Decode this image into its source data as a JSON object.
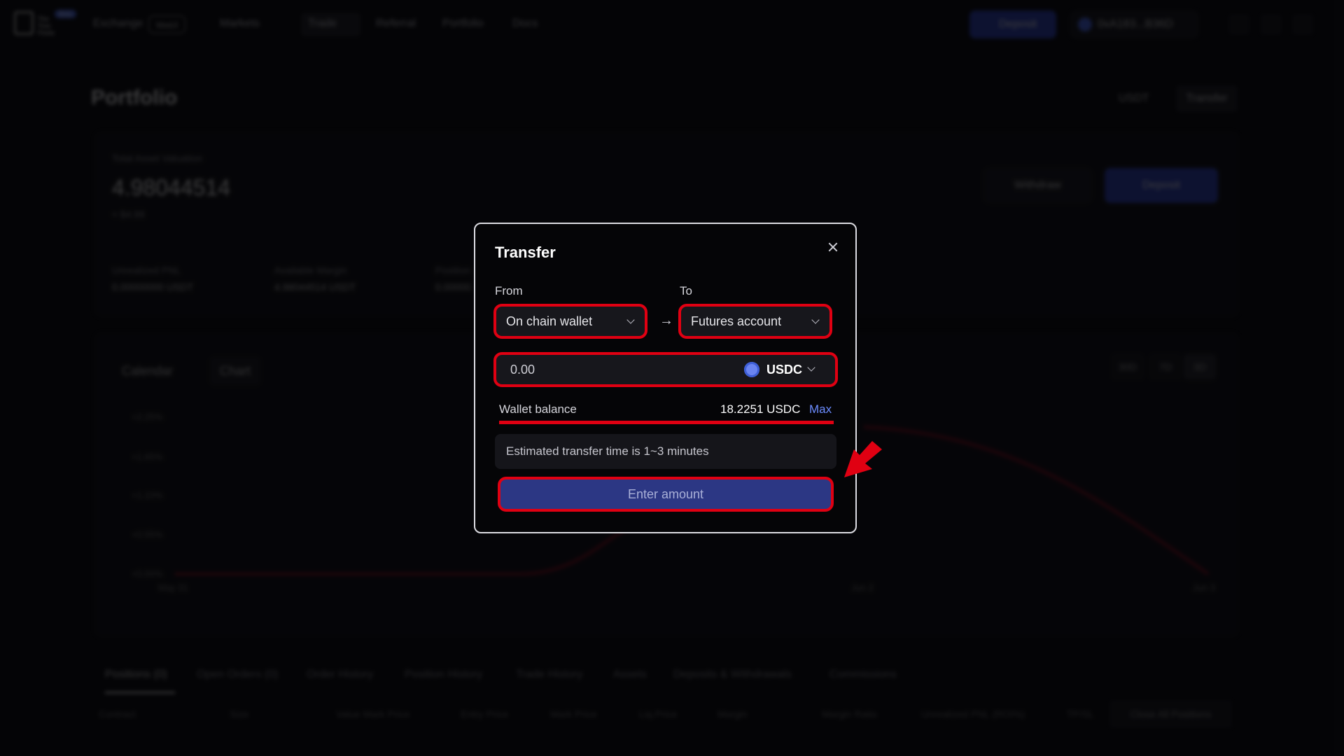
{
  "nav": {
    "logo_text": "The\nTree\nFinds",
    "logo_badge": "Beta",
    "exchange": "Exchange",
    "exchange_badge": "Web3",
    "markets": "Markets",
    "trade": "Trade",
    "referral": "Referral",
    "portfolio": "Portfolio",
    "docs": "Docs",
    "deposit": "Deposit",
    "wallet": "0xA183...B36D"
  },
  "page": {
    "title": "Portfolio",
    "currency": "USDT",
    "transfer": "Transfer"
  },
  "summary": {
    "label": "Total Asset Valuation",
    "value": "4.98044514",
    "usd": "≈ $4.98",
    "stats": [
      {
        "label": "Unrealized PNL",
        "value": "0.00000000 USDT"
      },
      {
        "label": "Available Margin",
        "value": "4.98044514 USDT"
      },
      {
        "label": "Position",
        "value": "0.00000"
      }
    ],
    "withdraw": "Withdraw",
    "deposit": "Deposit"
  },
  "chart": {
    "tabs": [
      "Calendar",
      "Chart"
    ],
    "ranges": [
      "30D",
      "7D",
      "3D"
    ],
    "yticks": [
      "+2.25%",
      "+1.65%",
      "+1.10%",
      "+0.55%",
      "+0.00%"
    ],
    "xticks": [
      "May 31",
      "Jun 2",
      "Jun 3"
    ]
  },
  "bottom_tabs": [
    "Positions (0)",
    "Open Orders (0)",
    "Order History",
    "Position History",
    "Trade History",
    "Assets",
    "Deposits & Withdrawals",
    "Commissions"
  ],
  "table_headers": [
    "Contract",
    "Size",
    "Value Mark Price",
    "Entry Price",
    "Mark Price",
    "Liq.Price",
    "Margin",
    "Margin Ratio",
    "Unrealized PNL (ROI%)",
    "TP/SL"
  ],
  "close_all": "Close All Positions",
  "modal": {
    "title": "Transfer",
    "from_label": "From",
    "to_label": "To",
    "from_value": "On chain wallet",
    "to_value": "Futures account",
    "amount_placeholder": "0.00",
    "token": "USDC",
    "balance_label": "Wallet balance",
    "balance_value": "18.2251 USDC",
    "max_label": "Max",
    "info": "Estimated transfer time is 1~3 minutes",
    "submit": "Enter amount"
  },
  "colors": {
    "annotation": "#e00012",
    "primary": "#2c3784",
    "link": "#6c8cff"
  }
}
